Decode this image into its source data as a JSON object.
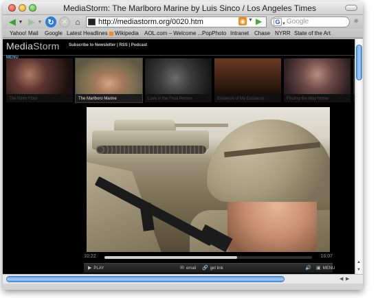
{
  "window": {
    "title": "MediaStorm: The Marlboro Marine by Luis Sinco / Los Angeles Times"
  },
  "toolbar": {
    "url": "http://mediastorm.org/0020.htm",
    "search_placeholder": "Google",
    "search_engine_icon": "G"
  },
  "bookmarks": [
    {
      "label": "Yahoo! Mail"
    },
    {
      "label": "Google"
    },
    {
      "label": "Latest Headlines",
      "rss": true
    },
    {
      "label": "Wikipedia"
    },
    {
      "label": "AOL.com – Welcome ..."
    },
    {
      "label": "PopPhoto"
    },
    {
      "label": "Intranet"
    },
    {
      "label": "Chase"
    },
    {
      "label": "NYRR"
    },
    {
      "label": "State of the Art"
    }
  ],
  "site": {
    "logo_main": "Media",
    "logo_accent": "Storm",
    "header_links": "Subscribe to Newsletter | RSS | Podcast",
    "menu_label": "MENU",
    "thumbnails": [
      {
        "label": "The Ninth Floor",
        "active": false,
        "tone": "#4a2a26"
      },
      {
        "label": "The Marlboro Marine",
        "active": true,
        "tone": "#8b7a5d"
      },
      {
        "label": "Love in the Final Person",
        "active": false,
        "tone": "#2d2d2d"
      },
      {
        "label": "Evidence of My Existence",
        "active": false,
        "tone": "#3a2216"
      },
      {
        "label": "Finding the Way Home",
        "active": false,
        "tone": "#3c2a30"
      },
      {
        "label": "Se",
        "active": false,
        "tone": "#2a2a2a"
      }
    ]
  },
  "player": {
    "current_time": "10:22",
    "total_time": "16:07",
    "progress_fraction": 0.64,
    "play_label": "PLAY",
    "email_label": "email",
    "link_label": "get link",
    "menu_label": "MENU"
  }
}
